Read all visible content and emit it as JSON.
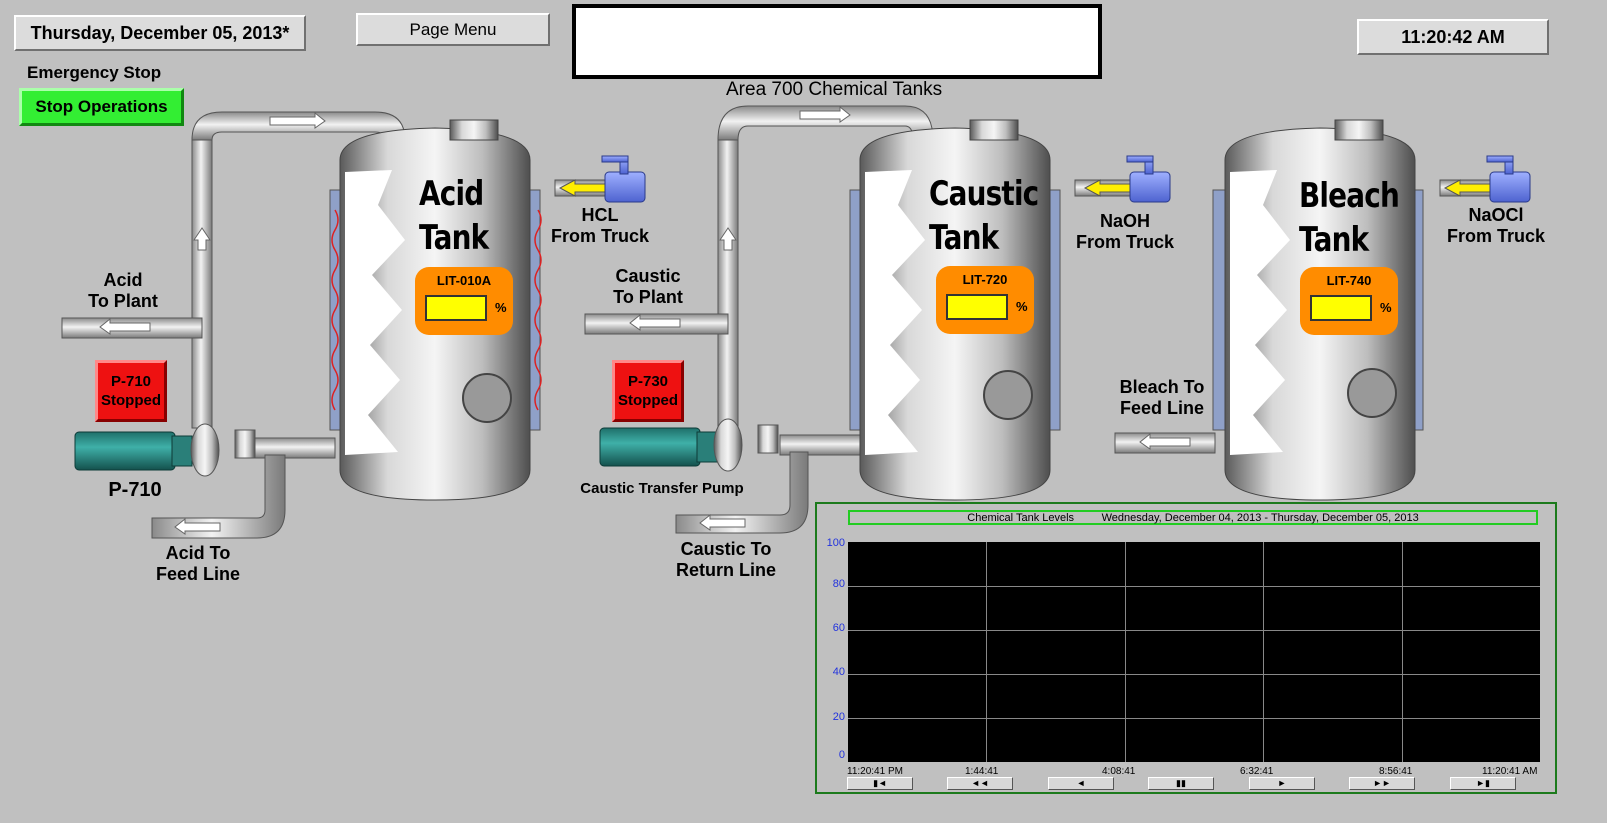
{
  "header": {
    "date": "Thursday, December 05, 2013*",
    "time": "11:20:42 AM",
    "page_menu_label": "Page Menu",
    "area_title": "Area 700 Chemical Tanks"
  },
  "emergency": {
    "label": "Emergency Stop",
    "button_label": "Stop Operations"
  },
  "tanks": [
    {
      "name": "Acid\nTank",
      "gauge_tag": "LIT-010A",
      "unit": "%",
      "inlet": "HCL\nFrom Truck"
    },
    {
      "name": "Caustic\nTank",
      "gauge_tag": "LIT-720",
      "unit": "%",
      "inlet": "NaOH\nFrom Truck"
    },
    {
      "name": "Bleach\nTank",
      "gauge_tag": "LIT-740",
      "unit": "%",
      "inlet": "NaOCl\nFrom Truck"
    }
  ],
  "pumps": [
    {
      "status_id": "P-710",
      "status": "Stopped",
      "label": "P-710"
    },
    {
      "status_id": "P-730",
      "status": "Stopped",
      "label": "Caustic Transfer Pump"
    }
  ],
  "lines": {
    "acid_to_plant": "Acid\nTo Plant",
    "caustic_to_plant": "Caustic\nTo Plant",
    "acid_to_feed": "Acid To\nFeed Line",
    "caustic_to_return": "Caustic To\nReturn Line",
    "bleach_to_feed": "Bleach To\nFeed Line"
  },
  "trend": {
    "header_title": "Chemical Tank Levels",
    "header_range": "Wednesday, December 04, 2013 - Thursday, December 05, 2013",
    "y_ticks": [
      "100",
      "80",
      "60",
      "40",
      "20",
      "0"
    ],
    "x_ticks": [
      "11:20:41 PM",
      "1:44:41",
      "4:08:41",
      "6:32:41",
      "8:56:41",
      "11:20:41 AM"
    ],
    "nav_buttons": [
      "▮◄",
      "◄◄",
      "◄",
      "▮▮",
      "►",
      "►►",
      "►▮"
    ]
  },
  "colors": {
    "background": "#c0c0c0",
    "stop_button": "#33ee33",
    "pump_stopped": "#ee1111",
    "gauge": "#ff8c00",
    "gauge_value": "#ffff00",
    "trend_plot": "#000000"
  },
  "chart_data": {
    "type": "line",
    "title": "Chemical Tank Levels",
    "subtitle": "Wednesday, December 04, 2013 - Thursday, December 05, 2013",
    "ylim": [
      0,
      100
    ],
    "y_ticks": [
      100,
      80,
      60,
      40,
      20,
      0
    ],
    "x_ticks": [
      "11:20:41 PM",
      "1:44:41",
      "4:08:41",
      "6:32:41",
      "8:56:41",
      "11:20:41 AM"
    ],
    "grid": true,
    "series": []
  }
}
